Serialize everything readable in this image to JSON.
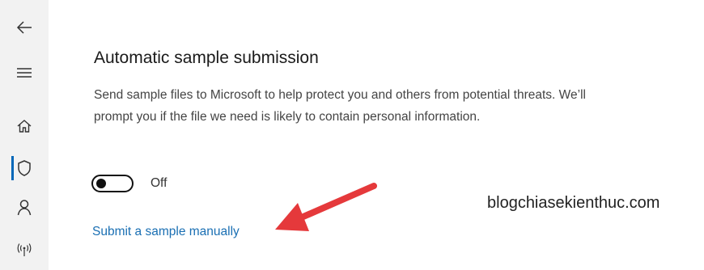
{
  "sidebar": {
    "items": [
      {
        "icon": "back-arrow-icon"
      },
      {
        "icon": "hamburger-menu-icon"
      },
      {
        "icon": "home-icon"
      },
      {
        "icon": "shield-icon",
        "active": true
      },
      {
        "icon": "person-icon"
      },
      {
        "icon": "wireless-antenna-icon"
      }
    ]
  },
  "section": {
    "title": "Automatic sample submission",
    "description": "Send sample files to Microsoft to help protect you and others from potential threats. We’ll prompt you if the file we need is likely to contain personal information.",
    "toggle": {
      "state": "off",
      "label": "Off"
    },
    "link": "Submit a sample manually"
  },
  "watermark": "blogchiasekienthuc.com",
  "colors": {
    "accent": "#0067b8",
    "link": "#1a6fb3",
    "annotation_arrow": "#e5393b",
    "sidebar_bg": "#f2f2f2"
  }
}
